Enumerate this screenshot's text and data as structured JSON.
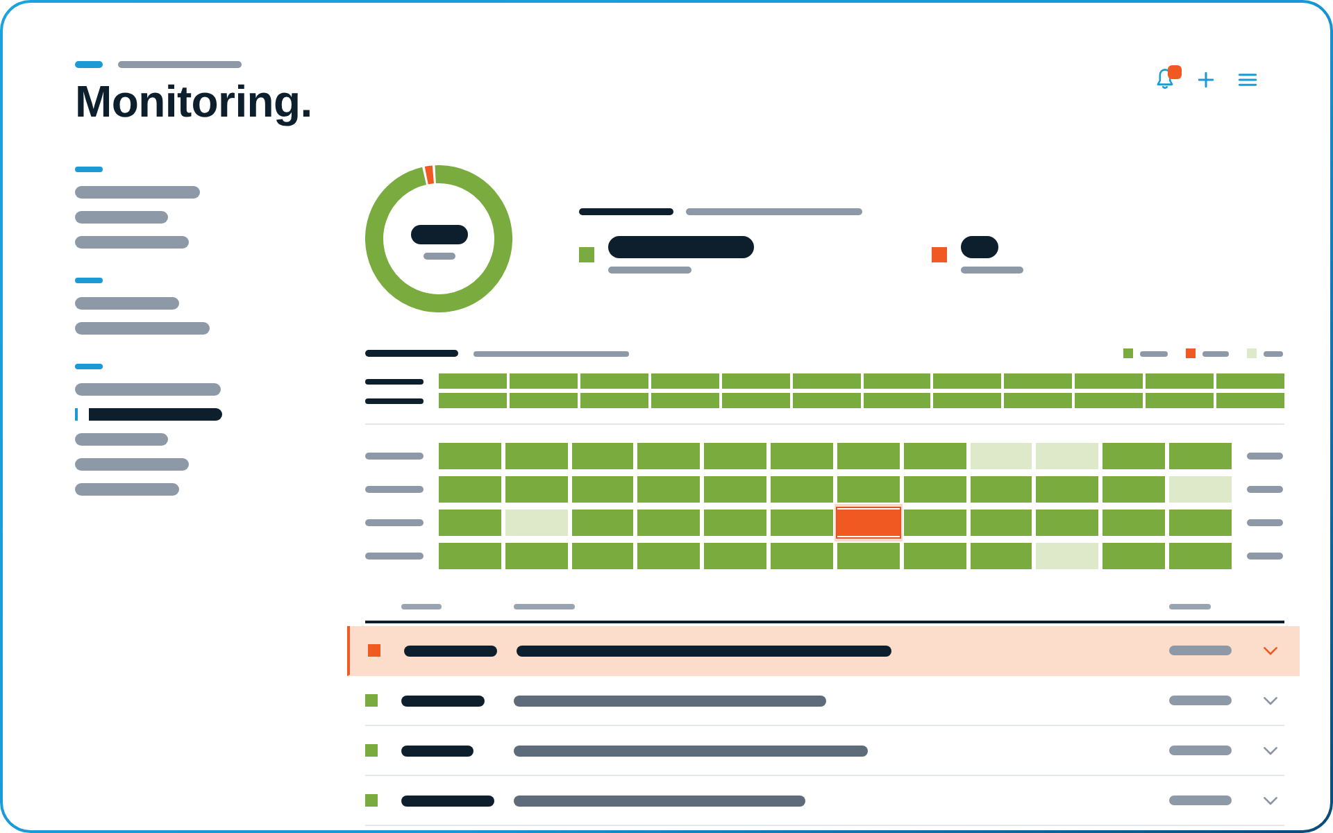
{
  "page": {
    "title": "Monitoring."
  },
  "toolbar": [
    {
      "kind": "bell",
      "badge": true
    },
    {
      "kind": "add",
      "badge": false
    },
    {
      "kind": "menu",
      "badge": false
    }
  ],
  "sidebar": {
    "groups": [
      {
        "items": [
          {
            "selected": false
          },
          {
            "selected": false
          },
          {
            "selected": false
          }
        ]
      },
      {
        "items": [
          {
            "selected": false
          },
          {
            "selected": false
          }
        ]
      },
      {
        "items": [
          {
            "selected": false
          },
          {
            "selected": true
          },
          {
            "selected": false
          },
          {
            "selected": false
          },
          {
            "selected": false
          }
        ]
      }
    ]
  },
  "summary": {
    "stats": [
      {
        "color": "#7aab3e"
      },
      {
        "color": "#f05a22"
      }
    ]
  },
  "legend": [
    {
      "color": "#7aab3e"
    },
    {
      "color": "#f05a22"
    },
    {
      "color": "#dde9c8"
    }
  ],
  "band": {
    "rows": [
      {
        "cells": [
          {
            "color": "#7aab3e"
          },
          {
            "color": "#7aab3e"
          },
          {
            "color": "#7aab3e"
          },
          {
            "color": "#7aab3e"
          },
          {
            "color": "#7aab3e"
          },
          {
            "color": "#7aab3e"
          },
          {
            "color": "#7aab3e"
          },
          {
            "color": "#7aab3e"
          },
          {
            "color": "#7aab3e"
          },
          {
            "color": "#7aab3e"
          },
          {
            "color": "#7aab3e"
          },
          {
            "color": "#7aab3e"
          }
        ]
      },
      {
        "cells": [
          {
            "color": "#7aab3e"
          },
          {
            "color": "#7aab3e"
          },
          {
            "color": "#7aab3e"
          },
          {
            "color": "#7aab3e"
          },
          {
            "color": "#7aab3e"
          },
          {
            "color": "#7aab3e"
          },
          {
            "color": "#7aab3e"
          },
          {
            "color": "#7aab3e"
          },
          {
            "color": "#7aab3e"
          },
          {
            "color": "#7aab3e"
          },
          {
            "color": "#7aab3e"
          },
          {
            "color": "#7aab3e"
          }
        ]
      }
    ]
  },
  "heatmap": {
    "rows": [
      {
        "cells": [
          {
            "color": "#7aab3e",
            "selected": false
          },
          {
            "color": "#7aab3e",
            "selected": false
          },
          {
            "color": "#7aab3e",
            "selected": false
          },
          {
            "color": "#7aab3e",
            "selected": false
          },
          {
            "color": "#7aab3e",
            "selected": false
          },
          {
            "color": "#7aab3e",
            "selected": false
          },
          {
            "color": "#7aab3e",
            "selected": false
          },
          {
            "color": "#7aab3e",
            "selected": false
          },
          {
            "color": "#dde9c8",
            "selected": false
          },
          {
            "color": "#dde9c8",
            "selected": false
          },
          {
            "color": "#7aab3e",
            "selected": false
          },
          {
            "color": "#7aab3e",
            "selected": false
          }
        ]
      },
      {
        "cells": [
          {
            "color": "#7aab3e",
            "selected": false
          },
          {
            "color": "#7aab3e",
            "selected": false
          },
          {
            "color": "#7aab3e",
            "selected": false
          },
          {
            "color": "#7aab3e",
            "selected": false
          },
          {
            "color": "#7aab3e",
            "selected": false
          },
          {
            "color": "#7aab3e",
            "selected": false
          },
          {
            "color": "#7aab3e",
            "selected": false
          },
          {
            "color": "#7aab3e",
            "selected": false
          },
          {
            "color": "#7aab3e",
            "selected": false
          },
          {
            "color": "#7aab3e",
            "selected": false
          },
          {
            "color": "#7aab3e",
            "selected": false
          },
          {
            "color": "#dde9c8",
            "selected": false
          }
        ]
      },
      {
        "cells": [
          {
            "color": "#7aab3e",
            "selected": false
          },
          {
            "color": "#dde9c8",
            "selected": false
          },
          {
            "color": "#7aab3e",
            "selected": false
          },
          {
            "color": "#7aab3e",
            "selected": false
          },
          {
            "color": "#7aab3e",
            "selected": false
          },
          {
            "color": "#7aab3e",
            "selected": false
          },
          {
            "color": "#f05a22",
            "selected": true
          },
          {
            "color": "#7aab3e",
            "selected": false
          },
          {
            "color": "#7aab3e",
            "selected": false
          },
          {
            "color": "#7aab3e",
            "selected": false
          },
          {
            "color": "#7aab3e",
            "selected": false
          },
          {
            "color": "#7aab3e",
            "selected": false
          }
        ]
      },
      {
        "cells": [
          {
            "color": "#7aab3e",
            "selected": false
          },
          {
            "color": "#7aab3e",
            "selected": false
          },
          {
            "color": "#7aab3e",
            "selected": false
          },
          {
            "color": "#7aab3e",
            "selected": false
          },
          {
            "color": "#7aab3e",
            "selected": false
          },
          {
            "color": "#7aab3e",
            "selected": false
          },
          {
            "color": "#7aab3e",
            "selected": false
          },
          {
            "color": "#7aab3e",
            "selected": false
          },
          {
            "color": "#7aab3e",
            "selected": false
          },
          {
            "color": "#dde9c8",
            "selected": false
          },
          {
            "color": "#7aab3e",
            "selected": false
          },
          {
            "color": "#7aab3e",
            "selected": false
          }
        ]
      }
    ]
  },
  "table": {
    "rows": [
      {
        "color": "#f05a22",
        "selected": true
      },
      {
        "color": "#7aab3e",
        "selected": false
      },
      {
        "color": "#7aab3e",
        "selected": false
      },
      {
        "color": "#7aab3e",
        "selected": false
      }
    ]
  }
}
